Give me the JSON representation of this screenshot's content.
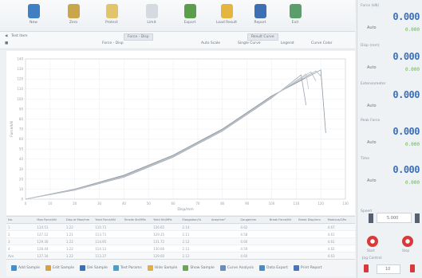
{
  "ribbon": {
    "buttons": [
      {
        "name": "ribbon-new-button",
        "icon": "blue-flask-icon",
        "label": "New"
      },
      {
        "name": "ribbon-zero-button",
        "icon": "hourglass-icon",
        "label": "Zero"
      },
      {
        "name": "ribbon-protect-button",
        "icon": "lock-icon",
        "label": "Protect"
      },
      {
        "name": "ribbon-limit-button",
        "icon": "limit-icon",
        "label": "Limit"
      },
      {
        "name": "ribbon-export-button",
        "icon": "green-upload-icon",
        "label": "Export"
      },
      {
        "name": "ribbon-load-button",
        "icon": "folder-icon",
        "label": "Load Result"
      },
      {
        "name": "ribbon-report-button",
        "icon": "document-icon",
        "label": "Report"
      },
      {
        "name": "ribbon-exit-button",
        "icon": "exit-icon",
        "label": "Exit"
      }
    ]
  },
  "subbar": {
    "left_title": "Test Item",
    "center_tab": "Force - Disp",
    "center_label": "Force - Disp",
    "right_tab": "Result Curve",
    "right_links": [
      "Auto Scale",
      "Single Curve",
      "Legend",
      "Curve Color"
    ]
  },
  "chart_data": {
    "type": "line",
    "title": "",
    "xlabel": "Disp/mm",
    "ylabel": "Force/kN",
    "xlim": [
      0,
      130
    ],
    "ylim": [
      0,
      140
    ],
    "xticks": [
      "0",
      "10",
      "20",
      "30",
      "40",
      "50",
      "60",
      "70",
      "80",
      "90",
      "100",
      "110",
      "120",
      "130"
    ],
    "yticks": [
      "0",
      "10",
      "20",
      "30",
      "40",
      "50",
      "60",
      "70",
      "80",
      "90",
      "100",
      "110",
      "120",
      "130",
      "140"
    ],
    "grid": true,
    "series": [
      {
        "x": [
          0,
          20,
          40,
          60,
          80,
          100,
          112,
          114
        ],
        "y": [
          0,
          9,
          22,
          42,
          68,
          101,
          124,
          94
        ]
      },
      {
        "x": [
          0,
          20,
          40,
          60,
          80,
          100,
          116,
          118
        ],
        "y": [
          0,
          9.5,
          23,
          43,
          69,
          102,
          127,
          118
        ]
      },
      {
        "x": [
          0,
          20,
          40,
          60,
          80,
          100,
          120,
          122
        ],
        "y": [
          0,
          10,
          24,
          44,
          70,
          103,
          129,
          66
        ]
      },
      {
        "x": [
          0,
          20,
          40,
          60,
          80,
          100,
          118,
          120
        ],
        "y": [
          0,
          9.8,
          23.5,
          43.5,
          69.5,
          102.5,
          128,
          123
        ]
      },
      {
        "x": [
          0,
          20,
          40,
          60,
          80,
          100,
          114,
          115
        ],
        "y": [
          0,
          9.2,
          22.5,
          42.5,
          68.5,
          101.5,
          125,
          110
        ]
      }
    ]
  },
  "table": {
    "headers": [
      "No.",
      "Max Force/kN",
      "Disp at Max/mm",
      "Yield Force/kN",
      "Tensile Str/MPa",
      "Yield Str/MPa",
      "Elongation/%",
      "Area/mm²",
      "Gauge/mm",
      "Break Force/kN",
      "Break Disp/mm",
      "Modulus/GPa"
    ],
    "rows": [
      [
        "1",
        "124.51",
        "1.22",
        "110.71",
        "",
        "126.65",
        "2.14",
        "",
        "4.62",
        "",
        "",
        "4.67"
      ],
      [
        "2",
        "127.12",
        "1.21",
        "113.71",
        "",
        "129.35",
        "2.11",
        "",
        "4.58",
        "",
        "",
        "4.61"
      ],
      [
        "3",
        "129.30",
        "1.22",
        "114.95",
        "",
        "131.72",
        "2.12",
        "",
        "4.60",
        "",
        "",
        "4.61"
      ],
      [
        "4",
        "128.44",
        "1.22",
        "114.12",
        "",
        "130.66",
        "2.12",
        "",
        "4.59",
        "",
        "",
        "4.62"
      ],
      [
        "Ave",
        "127.34",
        "1.22",
        "113.37",
        "",
        "129.60",
        "2.12",
        "",
        "4.60",
        "",
        "",
        "4.63"
      ]
    ]
  },
  "bottombar": {
    "buttons": [
      {
        "name": "add-sample-button",
        "color": "#3f8fd0",
        "label": "Add Sample"
      },
      {
        "name": "edit-sample-button",
        "color": "#d9a13b",
        "label": "Edit Sample"
      },
      {
        "name": "delete-sample-button",
        "color": "#3d6fb5",
        "label": "Del Sample"
      },
      {
        "name": "test-params-button",
        "color": "#4a9fc9",
        "label": "Test Params"
      },
      {
        "name": "hide-sample-button",
        "color": "#e0b040",
        "label": "Hide Sample"
      },
      {
        "name": "show-sample-button",
        "color": "#6aa84f",
        "label": "Show Sample"
      },
      {
        "name": "curve-analysis-button",
        "color": "#6c8cba",
        "label": "Curve Analysis"
      },
      {
        "name": "data-export-button",
        "color": "#3f8fd0",
        "label": "Data Export"
      },
      {
        "name": "print-report-button",
        "color": "#4b73b8",
        "label": "Print Report"
      }
    ]
  },
  "panel": {
    "meters": [
      {
        "caption": "Force (kN)",
        "value": "0.000",
        "unit": "Auto",
        "sub": "0.000"
      },
      {
        "caption": "Disp (mm)",
        "value": "0.000",
        "unit": "Auto",
        "sub": "0.000"
      },
      {
        "caption": "Extensometer",
        "value": "0.000",
        "unit": "Auto",
        "sub": ""
      },
      {
        "caption": "Peak Force",
        "value": "0.000",
        "unit": "Auto",
        "sub": "0.000"
      },
      {
        "caption": "Time",
        "value": "0.000",
        "unit": "Auto",
        "sub": "0.000"
      }
    ],
    "speed_label": "Speed",
    "speed_value": "5.000",
    "start_label": "Start",
    "stop_label": "Stop",
    "jog_label": "Jog Control",
    "jog_value": "10",
    "accent": "#3d6fb5",
    "ok_color": "#6cb34f",
    "stop_color": "#d83a3a"
  }
}
